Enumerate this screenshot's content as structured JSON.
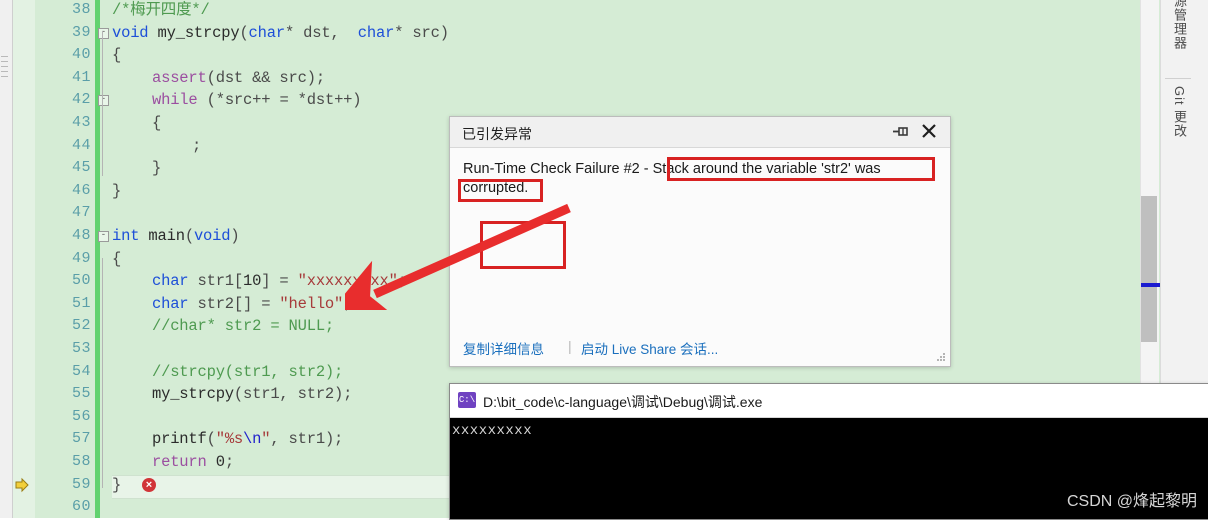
{
  "editor": {
    "change_bar_color": "#62d26f",
    "background": "#d5ecd5",
    "lines": [
      {
        "no": "38",
        "indent": 0,
        "tokens": [
          {
            "t": "/*梅开四度*/",
            "c": "cmt"
          }
        ]
      },
      {
        "no": "39",
        "indent": 0,
        "fold": "minus",
        "tokens": [
          {
            "t": "void",
            "c": "kw"
          },
          {
            "t": " ",
            "c": "id"
          },
          {
            "t": "my_strcpy",
            "c": "fn"
          },
          {
            "t": "(",
            "c": "id"
          },
          {
            "t": "char",
            "c": "kw"
          },
          {
            "t": "* ",
            "c": "id"
          },
          {
            "t": "dst",
            "c": "id"
          },
          {
            "t": ",  ",
            "c": "id"
          },
          {
            "t": "char",
            "c": "kw"
          },
          {
            "t": "* ",
            "c": "id"
          },
          {
            "t": "src",
            "c": "id"
          },
          {
            "t": ")",
            "c": "id"
          }
        ]
      },
      {
        "no": "40",
        "indent": 0,
        "tokens": [
          {
            "t": "{",
            "c": "id"
          }
        ]
      },
      {
        "no": "41",
        "indent": 1,
        "tokens": [
          {
            "t": "assert",
            "c": "pp"
          },
          {
            "t": "(",
            "c": "id"
          },
          {
            "t": "dst && src",
            "c": "id"
          },
          {
            "t": ");",
            "c": "id"
          }
        ]
      },
      {
        "no": "42",
        "indent": 1,
        "fold": "minus",
        "tokens": [
          {
            "t": "while",
            "c": "pp"
          },
          {
            "t": " (*",
            "c": "id"
          },
          {
            "t": "src",
            "c": "id"
          },
          {
            "t": "++ = *",
            "c": "id"
          },
          {
            "t": "dst",
            "c": "id"
          },
          {
            "t": "++)",
            "c": "id"
          }
        ]
      },
      {
        "no": "43",
        "indent": 1,
        "tokens": [
          {
            "t": "{",
            "c": "id"
          }
        ]
      },
      {
        "no": "44",
        "indent": 2,
        "tokens": [
          {
            "t": ";",
            "c": "id"
          }
        ]
      },
      {
        "no": "45",
        "indent": 1,
        "tokens": [
          {
            "t": "}",
            "c": "id"
          }
        ]
      },
      {
        "no": "46",
        "indent": 0,
        "tokens": [
          {
            "t": "}",
            "c": "id"
          }
        ]
      },
      {
        "no": "47",
        "indent": 0,
        "tokens": []
      },
      {
        "no": "48",
        "indent": 0,
        "fold": "minus",
        "tokens": [
          {
            "t": "int",
            "c": "kw"
          },
          {
            "t": " ",
            "c": "id"
          },
          {
            "t": "main",
            "c": "fn"
          },
          {
            "t": "(",
            "c": "id"
          },
          {
            "t": "void",
            "c": "kw"
          },
          {
            "t": ")",
            "c": "id"
          }
        ]
      },
      {
        "no": "49",
        "indent": 0,
        "tokens": [
          {
            "t": "{",
            "c": "id"
          }
        ]
      },
      {
        "no": "50",
        "indent": 1,
        "tokens": [
          {
            "t": "char",
            "c": "kw"
          },
          {
            "t": " str1[",
            "c": "id"
          },
          {
            "t": "10",
            "c": "num"
          },
          {
            "t": "] = ",
            "c": "id"
          },
          {
            "t": "\"xxxxxxxxx\"",
            "c": "str"
          },
          {
            "t": ";",
            "c": "id"
          }
        ]
      },
      {
        "no": "51",
        "indent": 1,
        "tokens": [
          {
            "t": "char",
            "c": "kw"
          },
          {
            "t": " str2[] = ",
            "c": "id"
          },
          {
            "t": "\"hello\"",
            "c": "str"
          },
          {
            "t": ";",
            "c": "id"
          }
        ]
      },
      {
        "no": "52",
        "indent": 1,
        "tokens": [
          {
            "t": "//char* str2 = NULL;",
            "c": "cmt"
          }
        ]
      },
      {
        "no": "53",
        "indent": 0,
        "tokens": []
      },
      {
        "no": "54",
        "indent": 1,
        "tokens": [
          {
            "t": "//strcpy(str1, str2);",
            "c": "cmt"
          }
        ]
      },
      {
        "no": "55",
        "indent": 1,
        "tokens": [
          {
            "t": "my_strcpy",
            "c": "fn"
          },
          {
            "t": "(str1, str2);",
            "c": "id"
          }
        ]
      },
      {
        "no": "56",
        "indent": 0,
        "tokens": []
      },
      {
        "no": "57",
        "indent": 1,
        "tokens": [
          {
            "t": "printf",
            "c": "fn"
          },
          {
            "t": "(",
            "c": "id"
          },
          {
            "t": "\"%s",
            "c": "str"
          },
          {
            "t": "\\n",
            "c": "esc"
          },
          {
            "t": "\"",
            "c": "str"
          },
          {
            "t": ", str1);",
            "c": "id"
          }
        ]
      },
      {
        "no": "58",
        "indent": 1,
        "tokens": [
          {
            "t": "return",
            "c": "pp"
          },
          {
            "t": " ",
            "c": "id"
          },
          {
            "t": "0",
            "c": "num"
          },
          {
            "t": ";",
            "c": "id"
          }
        ]
      },
      {
        "no": "59",
        "indent": 0,
        "tokens": [
          {
            "t": "}",
            "c": "id"
          }
        ],
        "error_marker": "✖",
        "exec_pointer": true
      },
      {
        "no": "60",
        "indent": 0,
        "tokens": []
      }
    ]
  },
  "right_tabs": [
    {
      "label": "源管理器",
      "name": "solution-explorer-tab"
    },
    {
      "label": "Git 更改",
      "name": "git-changes-tab"
    }
  ],
  "exception_dialog": {
    "title": "已引发异常",
    "message_prefix": "Run-Time Check Failure #2 - ",
    "message_highlight": "Stack around the variable 'str2' was corrupted.",
    "full_message": "Run-Time Check Failure #2 - Stack around the variable 'str2' was corrupted.",
    "link_copy": "复制详细信息",
    "link_separator": "|",
    "link_liveshare": "启动 Live Share 会话...",
    "pin_icon": "pin-icon",
    "close_icon": "close-icon"
  },
  "console_window": {
    "title": "D:\\bit_code\\c-language\\调试\\Debug\\调试.exe",
    "icon": "console-app-icon",
    "output": "xxxxxxxxx"
  },
  "watermark": {
    "text": "CSDN @烽起黎明"
  },
  "annotations": {
    "red_color": "#d82222",
    "arrow_from": "dialog message area",
    "arrow_to": "line 51 str2 declaration",
    "empty_box": ""
  }
}
